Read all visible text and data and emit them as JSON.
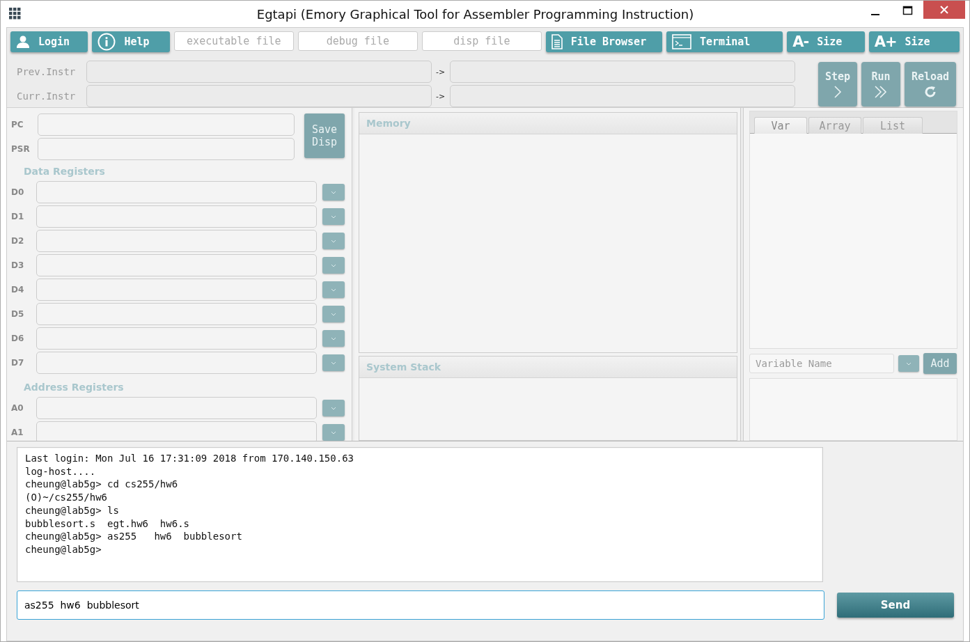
{
  "window": {
    "title": "Egtapi (Emory Graphical Tool for Assembler Programming Instruction)"
  },
  "toolbar": [
    {
      "kind": "button",
      "label": "Login"
    },
    {
      "kind": "button",
      "label": "Help"
    },
    {
      "kind": "field",
      "placeholder": "executable file"
    },
    {
      "kind": "field",
      "placeholder": "debug file"
    },
    {
      "kind": "field",
      "placeholder": "disp file"
    },
    {
      "kind": "button",
      "label": "File Browser"
    },
    {
      "kind": "button",
      "label": "Terminal"
    },
    {
      "kind": "button",
      "glyph": "A-",
      "label": "Size"
    },
    {
      "kind": "button",
      "glyph": "A+",
      "label": "Size"
    }
  ],
  "instructions": [
    {
      "label": "Prev.Instr",
      "arrow": "->"
    },
    {
      "label": "Curr.Instr",
      "arrow": "->"
    }
  ],
  "controls": [
    {
      "label": "Step",
      "disabled": true
    },
    {
      "label": "Run",
      "disabled": true
    },
    {
      "label": "Reload",
      "disabled": true
    }
  ],
  "registers": {
    "special": [
      {
        "label": "PC"
      },
      {
        "label": "PSR"
      }
    ],
    "save_button": {
      "lines": [
        "Save",
        "Disp"
      ],
      "disabled": true
    },
    "sections": [
      {
        "title": "Data Registers",
        "items": [
          {
            "label": "D0"
          },
          {
            "label": "D1"
          },
          {
            "label": "D2"
          },
          {
            "label": "D3"
          },
          {
            "label": "D4"
          },
          {
            "label": "D5"
          },
          {
            "label": "D6"
          },
          {
            "label": "D7"
          }
        ]
      },
      {
        "title": "Address Registers",
        "items": [
          {
            "label": "A0"
          },
          {
            "label": "A1"
          }
        ]
      }
    ]
  },
  "memory": {
    "title": "Memory"
  },
  "system_stack": {
    "title": "System Stack"
  },
  "variables": {
    "tabs": [
      {
        "label": "Var",
        "selected": true
      },
      {
        "label": "Array",
        "selected": false
      },
      {
        "label": "List",
        "selected": false
      }
    ],
    "name_field": {
      "placeholder": "Variable Name"
    },
    "add_button": {
      "label": "Add",
      "disabled": true
    }
  },
  "terminal": {
    "lines": [
      "Last login: Mon Jul 16 17:31:09 2018 from 170.140.150.63",
      "log-host....",
      "cheung@lab5g> cd cs255/hw6",
      "(O)~/cs255/hw6",
      "cheung@lab5g> ls",
      "bubblesort.s  egt.hw6  hw6.s",
      "cheung@lab5g> as255   hw6  bubblesort",
      "cheung@lab5g>"
    ],
    "input": {
      "value": "as255  hw6  bubblesort"
    },
    "send_button": {
      "label": "Send"
    }
  }
}
